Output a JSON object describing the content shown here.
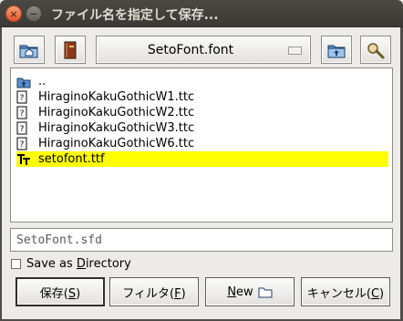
{
  "window": {
    "title": "ファイル名を指定して保存...",
    "close_glyph": "×",
    "minimize_glyph": "−"
  },
  "toolbar": {
    "home_icon": "home-folder-icon",
    "bookmark_icon": "bookmark-book-icon",
    "directory": "SetoFont.font",
    "up_icon": "parent-directory-icon",
    "search_icon": "magnifier-icon"
  },
  "files": [
    {
      "name": "..",
      "icon": "up-folder-icon",
      "selected": false
    },
    {
      "name": "HiraginoKakuGothicW1.ttc",
      "icon": "unknown-file-icon",
      "selected": false
    },
    {
      "name": "HiraginoKakuGothicW2.ttc",
      "icon": "unknown-file-icon",
      "selected": false
    },
    {
      "name": "HiraginoKakuGothicW3.ttc",
      "icon": "unknown-file-icon",
      "selected": false
    },
    {
      "name": "HiraginoKakuGothicW6.ttc",
      "icon": "unknown-file-icon",
      "selected": false
    },
    {
      "name": "setofont.ttf",
      "icon": "truetype-font-icon",
      "selected": true
    }
  ],
  "filename": "SetoFont.sfd",
  "save_as_directory": {
    "label_pre": "Save as ",
    "label_key": "D",
    "label_post": "irectory",
    "checked": false
  },
  "buttons": {
    "save": {
      "pre": "保存(",
      "key": "S",
      "post": ")"
    },
    "filter": {
      "pre": "フィルタ(",
      "key": "F",
      "post": ")"
    },
    "new": {
      "key": "N",
      "post": "ew"
    },
    "cancel": {
      "pre": "キャンセル(",
      "key": "C",
      "post": ")"
    }
  },
  "colors": {
    "selection": "#ffff00",
    "titlebar": "#3c3b37"
  }
}
